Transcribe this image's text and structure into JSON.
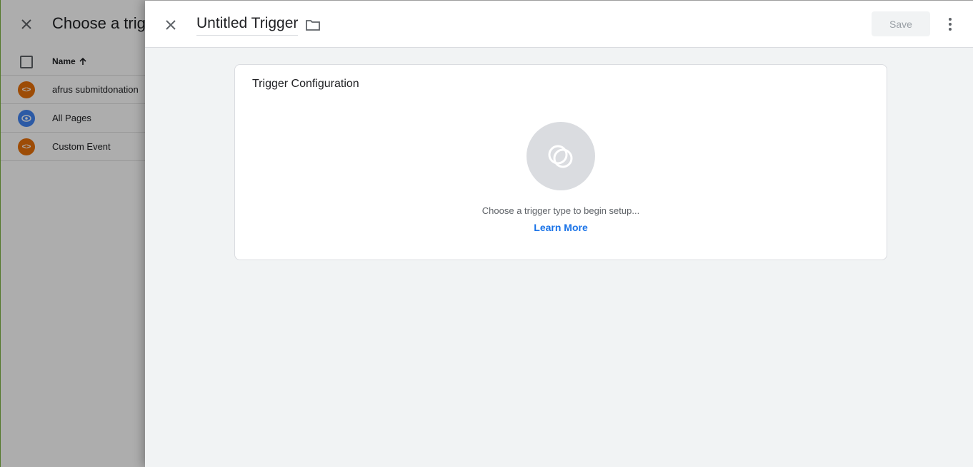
{
  "background_panel": {
    "title": "Choose a trigger",
    "column_name": "Name",
    "rows": [
      {
        "label": "afrus submitdonation",
        "icon": "code-icon",
        "color": "#e8710a"
      },
      {
        "label": "All Pages",
        "icon": "eye-icon",
        "color": "#4285f4"
      },
      {
        "label": "Custom Event",
        "icon": "code-icon",
        "color": "#e8710a"
      }
    ]
  },
  "editor": {
    "title": "Untitled Trigger",
    "save_label": "Save"
  },
  "card": {
    "title": "Trigger Configuration",
    "hint": "Choose a trigger type to begin setup...",
    "learn_more": "Learn More"
  },
  "colors": {
    "accent": "#1a73e8",
    "orange": "#e8710a",
    "blue": "#4285f4"
  }
}
